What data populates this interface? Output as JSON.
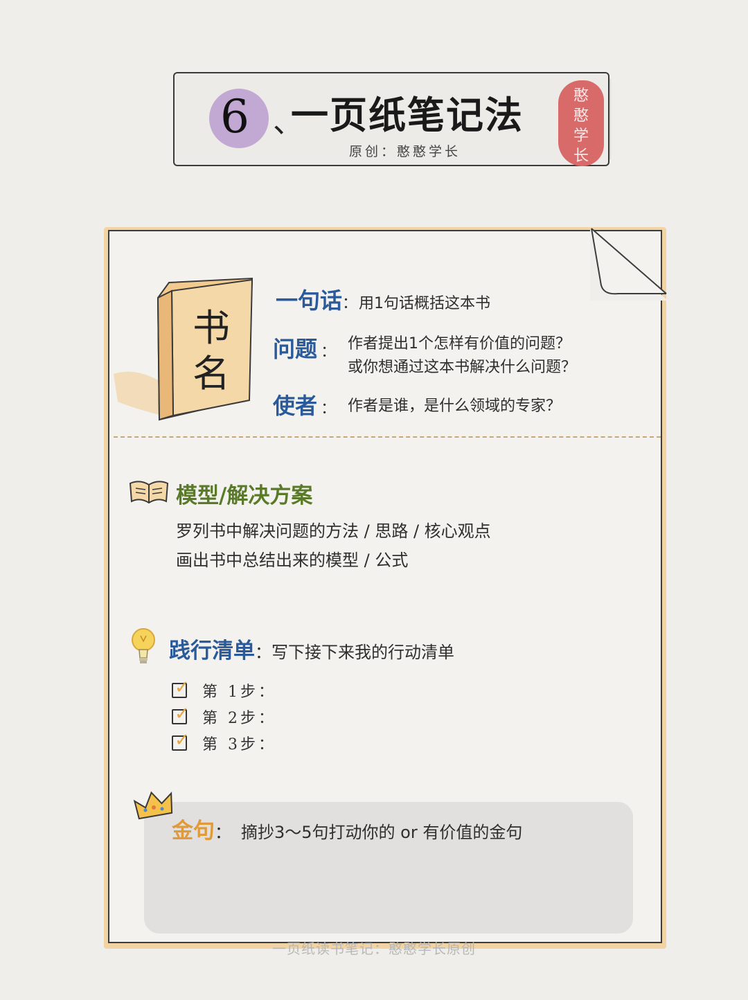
{
  "header": {
    "number": "6",
    "separator": "、",
    "title": "一页纸笔记法",
    "subtitle": "原创：憨憨学长",
    "seal": [
      "憨",
      "憨",
      "学",
      "长"
    ]
  },
  "book": {
    "cover": [
      "书",
      "名"
    ]
  },
  "summary": {
    "one_sentence": {
      "label": "一句话",
      "colon": "：",
      "text": "用1句话概括这本书"
    },
    "question": {
      "label": "问题",
      "colon": "：",
      "line1": "作者提出1个怎样有价值的问题？",
      "line2": "或你想通过这本书解决什么问题？"
    },
    "messenger": {
      "label": "使者",
      "colon": "：",
      "text": "作者是谁，是什么领域的专家？"
    }
  },
  "model": {
    "label": "模型/解决方案",
    "line1": "罗列书中解决问题的方法 / 思路 / 核心观点",
    "line2": "画出书中总结出来的模型 / 公式"
  },
  "practice": {
    "label": "践行清单",
    "colon": "：",
    "text": "写下接下来我的行动清单",
    "steps": [
      "第 1步：",
      "第 2步：",
      "第 3步："
    ]
  },
  "quotes": {
    "label": "金句",
    "colon": "：",
    "text": "摘抄3～5句打动你的 or 有价值的金句"
  },
  "footer": "一页纸读书笔记：憨憨学长原创",
  "colors": {
    "label_blue": "#2b5a9a",
    "label_green": "#5a7a2a",
    "label_gold": "#e09a3a",
    "seal_red": "#d96a6a",
    "number_purple": "#c2a9d4"
  },
  "icons": [
    "book-icon",
    "open-book-icon",
    "lightbulb-icon",
    "crown-icon",
    "checkbox-icon"
  ]
}
